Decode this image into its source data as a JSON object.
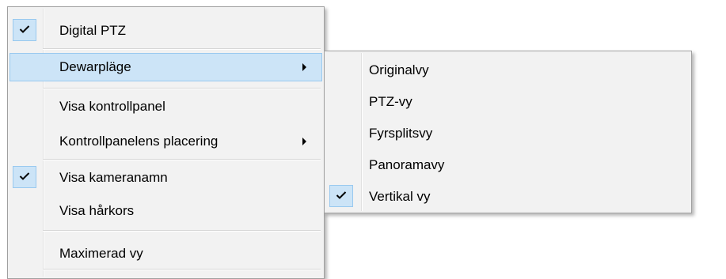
{
  "main_menu": {
    "items": [
      {
        "label": "Digital PTZ",
        "checked": true
      },
      {
        "label": "Dewarpläge",
        "has_submenu": true,
        "highlighted": true
      },
      {
        "label": "Visa kontrollpanel"
      },
      {
        "label": "Kontrollpanelens placering",
        "has_submenu": true
      },
      {
        "label": "Visa kameranamn",
        "checked": true
      },
      {
        "label": "Visa hårkors"
      },
      {
        "label": "Maximerad vy"
      }
    ]
  },
  "submenu": {
    "items": [
      {
        "label": "Originalvy"
      },
      {
        "label": "PTZ-vy"
      },
      {
        "label": "Fyrsplitsvy"
      },
      {
        "label": "Panoramavy"
      },
      {
        "label": "Vertikal vy",
        "checked": true
      }
    ]
  },
  "colors": {
    "highlight": "#cce4f7",
    "highlight_border": "#99c9ef",
    "menu_background": "#f2f2f2"
  }
}
